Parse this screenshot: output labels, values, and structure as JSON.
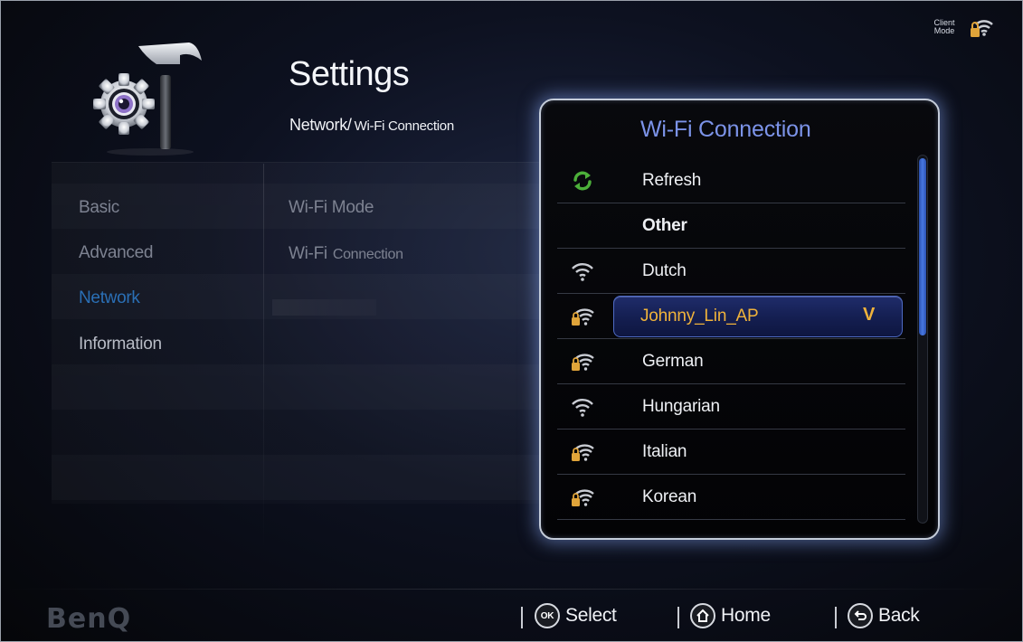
{
  "header": {
    "title": "Settings",
    "breadcrumb_main": "Network/",
    "breadcrumb_sub": "Wi-Fi Connection",
    "client_mode_label_line1": "Client",
    "client_mode_label_line2": "Mode",
    "client_mode_icon": "wifi-lock-icon"
  },
  "menu": {
    "items": [
      {
        "label": "Basic",
        "state": "inactive"
      },
      {
        "label": "Advanced",
        "state": "inactive"
      },
      {
        "label": "Network",
        "state": "active"
      },
      {
        "label": "Information",
        "state": "inactive"
      }
    ],
    "sub_items": [
      {
        "label_a": "Wi-Fi",
        "label_b": "Mode"
      },
      {
        "label_a": "Wi-Fi",
        "label_b": "Connection"
      }
    ]
  },
  "wifi_dialog": {
    "title": "Wi-Fi Connection",
    "rows": [
      {
        "name": "Refresh",
        "icon": "refresh-icon"
      },
      {
        "name": "Other",
        "icon": "none"
      },
      {
        "name": "Dutch",
        "icon": "wifi-icon"
      },
      {
        "name": "Johnny_Lin_AP",
        "icon": "wifi-lock-icon",
        "selected": true,
        "check": "V"
      },
      {
        "name": "German",
        "icon": "wifi-lock-icon"
      },
      {
        "name": "Hungarian",
        "icon": "wifi-icon"
      },
      {
        "name": "Italian",
        "icon": "wifi-lock-icon"
      },
      {
        "name": "Korean",
        "icon": "wifi-lock-icon"
      }
    ]
  },
  "footer": {
    "brand": "BenQ",
    "buttons": [
      {
        "label": "Select",
        "icon": "ok-icon",
        "icon_text": "OK"
      },
      {
        "label": "Home",
        "icon": "home-icon"
      },
      {
        "label": "Back",
        "icon": "back-icon"
      }
    ]
  },
  "colors": {
    "accent_blue": "#7c93e8",
    "active_menu": "#2a6fb5",
    "selected_text": "#f0b33b",
    "refresh_green": "#4caf3a"
  }
}
